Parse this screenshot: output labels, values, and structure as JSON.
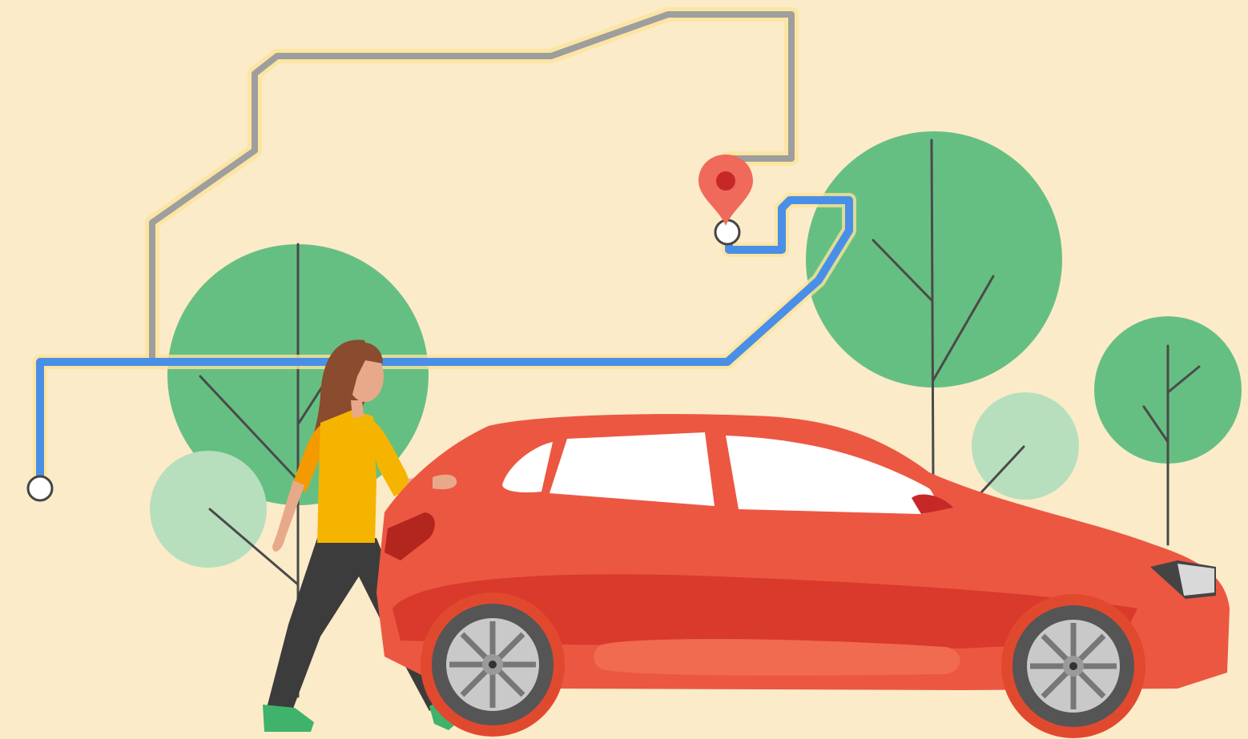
{
  "colors": {
    "background": "#fcebc8",
    "route_glow": "#fbe49a",
    "route_primary": "#4a8fe7",
    "route_alternate": "#9e9e9e",
    "pin": "#ef6a5a",
    "pin_center": "#c62828",
    "tree_dark": "#66bf82",
    "tree_light": "#b7dfbd",
    "branch": "#4a4a4a",
    "car_body": "#ec5742",
    "car_shadow_panel": "#d93a2b",
    "car_window": "#ffffff",
    "tire": "#555555",
    "rim": "#c9c9c9",
    "shirt": "#f5b400",
    "shirt_shade": "#f29a00",
    "hair": "#8a4b2e",
    "skin": "#e8a98a",
    "pants": "#3c3c3c",
    "shoes": "#3fb36b"
  },
  "icons": {
    "destination": "location-pin-icon",
    "route_start": "route-start-node",
    "route_end": "route-end-node"
  }
}
